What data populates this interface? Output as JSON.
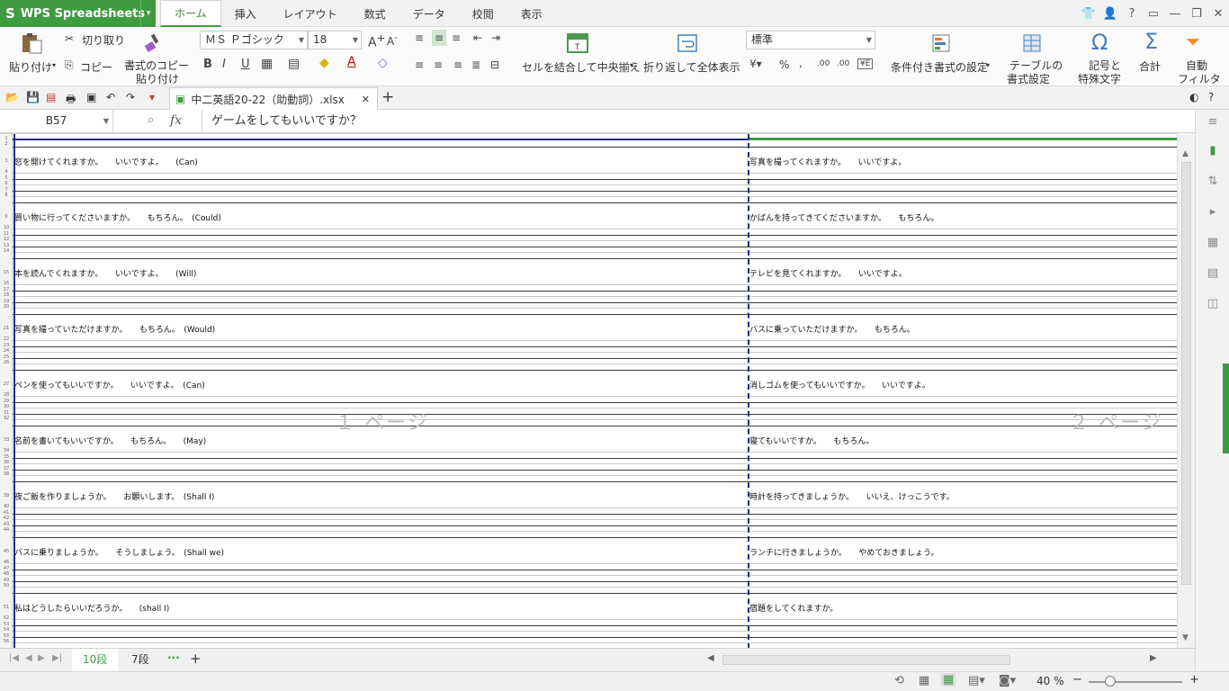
{
  "app": {
    "logo": "S",
    "name": "WPS Spreadsheets",
    "arrow": "▾"
  },
  "menu_tabs": [
    "ホーム",
    "挿入",
    "レイアウト",
    "数式",
    "データ",
    "校閲",
    "表示"
  ],
  "window_controls": [
    "▭",
    "—",
    "❐",
    "✕"
  ],
  "ribbon": {
    "paste": "貼り付け",
    "cut": "切り取り",
    "copy": "コピー",
    "format_copy_1": "書式のコピー",
    "format_copy_2": "貼り付け",
    "font_name": "ＭＳ Ｐゴシック",
    "font_size": "18",
    "bold": "B",
    "italic": "I",
    "underline": "U",
    "merge_center": "セルを結合して中央揃え",
    "wrap_text": "折り返して全体表示",
    "number_format": "標準",
    "percent": "%",
    "comma": ",",
    "inc_decimal": ".00",
    "dec_decimal": ".00",
    "cond_format": "条件付き書式の設定",
    "table_1": "テーブルの",
    "table_2": "書式設定",
    "symbol_1": "記号と",
    "symbol_2": "特殊文字",
    "sum": "合計",
    "filter_1": "自動",
    "filter_2": "フィルタ"
  },
  "document_tab": {
    "title": "中二英語20-22（助動詞）.xlsx",
    "close": "✕",
    "add": "+"
  },
  "formula_bar": {
    "cell_ref": "B57",
    "fx": "fx",
    "content": "ゲームをしてもいいですか？"
  },
  "sheet": {
    "left_cells": [
      "窓を開けてくれますか。　　いいですよ。　　(Can)",
      "買い物に行ってくださいますか。　　もちろん。　(Could)",
      "本を読んでくれますか。　　いいですよ。　　(Will)",
      "写真を撮っていただけますか。　　もちろん。　(Would)",
      "ペンを使ってもいいですか。　　いいですよ。　(Can)",
      "名前を書いてもいいですか。　　もちろん。　　(May)",
      "夜ご飯を作りましょうか。　　お願いします。　(Shall I)",
      "バスに乗りましょうか。　　そうしましょう。　(Shall we)",
      "私はどうしたらいいだろうか。　　(shall I)"
    ],
    "right_cells": [
      "写真を撮ってくれますか。　　いいですよ。",
      "かばんを持ってきてくださいますか。　　もちろん。",
      "テレビを見てくれますか。　　いいですよ。",
      "バスに乗っていただけますか。　　もちろん。",
      "消しゴムを使ってもいいですか。　　いいですよ。",
      "寝てもいいですか。　　もちろん。",
      "時計を持ってきましょうか。　　いいえ、けっこうです。",
      "ランチに行きましょうか。　　やめておきましょう。",
      "宿題をしてくれますか。"
    ],
    "page_labels": [
      "１ ページ",
      "２ ページ"
    ]
  },
  "sheet_tabs": [
    "10段",
    "7段"
  ],
  "status": {
    "zoom": "40 %"
  },
  "colors": {
    "brand_green": "#3f9b3f",
    "page_break_blue": "#1a2b8c"
  }
}
